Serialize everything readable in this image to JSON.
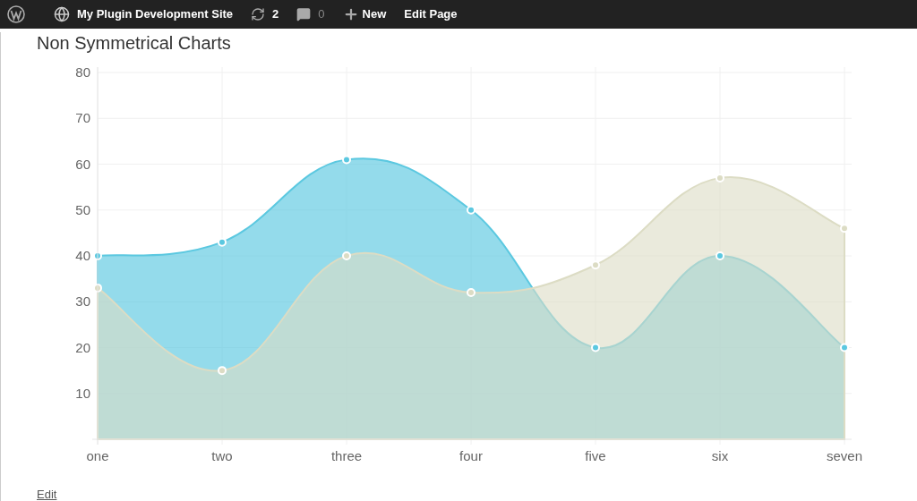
{
  "admin_bar": {
    "site_name": "My Plugin Development Site",
    "updates": "2",
    "comments": "0",
    "new_label": "New",
    "edit_page": "Edit Page"
  },
  "page": {
    "title": "Non Symmetrical Charts",
    "edit_link": "Edit"
  },
  "chart": {
    "chart_data": {
      "type": "area",
      "categories": [
        "one",
        "two",
        "three",
        "four",
        "five",
        "six",
        "seven"
      ],
      "series": [
        {
          "color": "#5bc8e0",
          "values": [
            40,
            43,
            61,
            50,
            20,
            40,
            20
          ]
        },
        {
          "color": "#dcdcc4",
          "values": [
            33,
            15,
            40,
            32,
            38,
            57,
            46
          ]
        }
      ],
      "grid": true,
      "ylim": [
        0,
        80
      ],
      "yticks": [
        10,
        20,
        30,
        40,
        50,
        60,
        70,
        80
      ]
    }
  }
}
